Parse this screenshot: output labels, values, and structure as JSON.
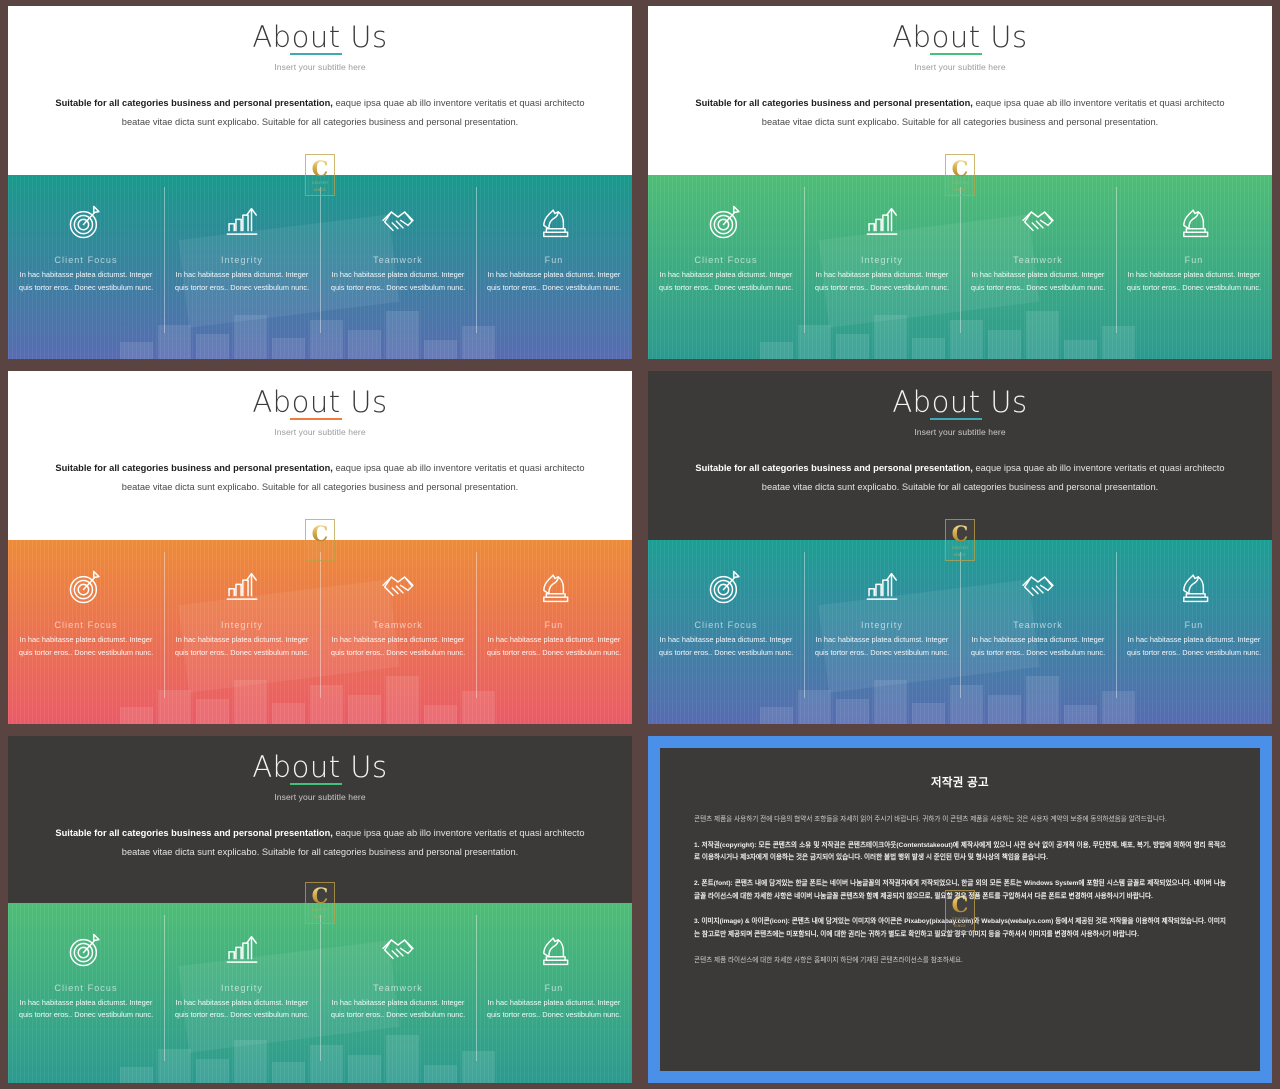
{
  "slide": {
    "title": "About Us",
    "subtitle": "Insert your subtitle here",
    "body_bold": "Suitable for all categories business and personal presentation,",
    "body_rest": " eaque ipsa quae ab illo inventore veritatis et quasi architecto beatae vitae dicta sunt explicabo. Suitable for all categories business and personal presentation.",
    "badge": {
      "letter": "C",
      "sub_line1": "CENTER",
      "sub_line2": "SINCE"
    },
    "columns": [
      {
        "title": "Client  Focus",
        "desc": "In hac habitasse platea dictumst. Integer quis tortor eros.. Donec vestibulum nunc.",
        "icon": "target-icon"
      },
      {
        "title": "Integrity",
        "desc": "In hac habitasse platea dictumst. Integer quis tortor eros.. Donec vestibulum nunc.",
        "icon": "growth-bar-chart-icon"
      },
      {
        "title": "Teamwork",
        "desc": "In hac habitasse platea dictumst. Integer quis tortor eros.. Donec vestibulum nunc.",
        "icon": "handshake-icon"
      },
      {
        "title": "Fun",
        "desc": "In hac habitasse platea dictumst. Integer quis tortor eros.. Donec vestibulum nunc.",
        "icon": "chess-knight-icon"
      }
    ]
  },
  "variants": [
    {
      "id": "variant-teal-light",
      "top": "light",
      "accent": "#3FA9B5",
      "band_from": "#1b9e8f",
      "band_to": "#5b6fb5"
    },
    {
      "id": "variant-green-light",
      "top": "light",
      "accent": "#45C17E",
      "band_from": "#53c27a",
      "band_to": "#2f9e93"
    },
    {
      "id": "variant-orange-light",
      "top": "light",
      "accent": "#F07B3F",
      "band_from": "#f2903d",
      "band_to": "#ee5f6b"
    },
    {
      "id": "variant-teal-dark",
      "top": "dark",
      "accent": "#3FA9B5",
      "band_from": "#1fa397",
      "band_to": "#5b6fb5"
    },
    {
      "id": "variant-green-dark",
      "top": "dark",
      "accent": "#45C17E",
      "band_from": "#53c27a",
      "band_to": "#2f9e93"
    }
  ],
  "copyright": {
    "title": "저작권 공고",
    "paragraphs": [
      "콘텐츠 제품을 사용하기 전에 다음의 협약서 조항들을 자세히 읽어 주시기 바랍니다. 귀하가 이 콘텐츠 제품을 사용하는 것은 사용자 계약의 보증에 동의하셨음을 알려드립니다.",
      "1. 저작권(copyright): 모든 콘텐츠의 소유 및 저작권은 콘텐츠테이크아웃(Contentstakeout)에 제작사에게 있으니 사전 승낙 없이 공개적 이용, 무단전재, 배포, 복기, 방법에 의하여 영리 목적으로 이용하시거나 제3자에게 이용하는 것은 금지되어 있습니다. 이러한 불법 행위 발생 시 준인된 민사 및 형사상의 책임을 묻습니다.",
      "2. 폰트(font): 콘텐츠 내에 담겨있는 한글 폰트는 네이버 나눔글꼴의 저작권자에게 저작되었으니, 한글 외의 모든 폰트는 Windows System에 포함된 시스템 글꼴로 제작되었으니다. 네이버 나눔글꼴 라이선스에 대한 자세한 사항은 네이버 나눔글꼴 콘텐츠와 함께 제공되지 않으므로, 필요할 경우 정품 폰트를 구입하셔서 다른 폰트로 변경하여 사용하시기 바랍니다.",
      "3. 이미지(image) & 아이콘(icon): 콘텐츠 내에 담겨있는 이미지와 아이콘은 Pixaboy(pixabay.com)와 Webalys(webalys.com) 등에서 제공된 것로 저작물을 이용하여 제작되었습니다. 이미지는 참고로만 제공되며 콘텐츠에는 미포함되니, 이에 대한 권리는 귀하가 별도로 확인하고 필요할 경우 이미지 등을 구하셔서 이미지를 변경하여 사용하시기 바랍니다.",
      "콘텐츠 제품 라이선스에 대한 자세한 사항은 홈페이지 하단에 기재된 콘텐츠라이선스를 참조하세요."
    ]
  }
}
